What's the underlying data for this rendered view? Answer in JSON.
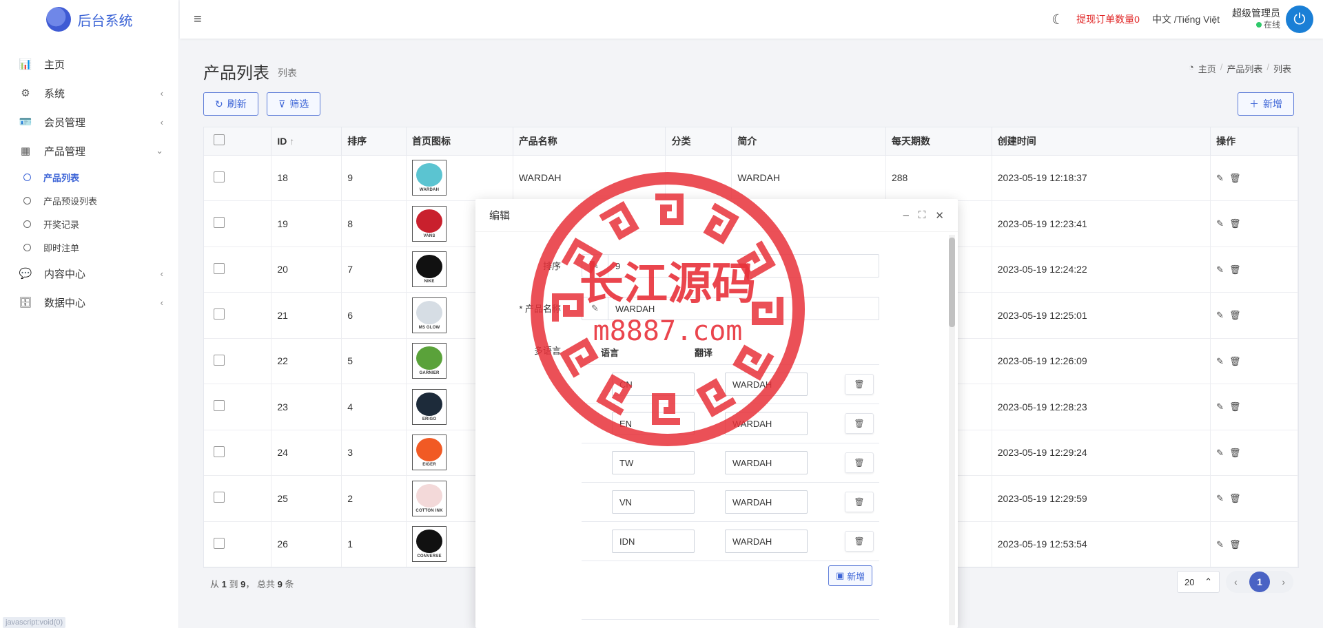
{
  "brand": {
    "name": "后台系统"
  },
  "sidebar": {
    "items": [
      {
        "label": "主页",
        "icon": "bar-chart-icon",
        "glyph": "📊",
        "has_chevron": false
      },
      {
        "label": "系统",
        "icon": "gear-icon",
        "glyph": "⚙",
        "has_chevron": true
      },
      {
        "label": "会员管理",
        "icon": "id-card-icon",
        "glyph": "🪪",
        "has_chevron": true
      },
      {
        "label": "产品管理",
        "icon": "grid-icon",
        "glyph": "▦",
        "has_chevron": true,
        "expanded": true
      }
    ],
    "sub_items": [
      {
        "label": "产品列表",
        "active": true
      },
      {
        "label": "产品预设列表",
        "active": false
      },
      {
        "label": "开奖记录",
        "active": false
      },
      {
        "label": "即时注单",
        "active": false
      }
    ],
    "items_after": [
      {
        "label": "内容中心",
        "icon": "chat-icon",
        "glyph": "💬"
      },
      {
        "label": "数据中心",
        "icon": "database-icon",
        "glyph": "🗄"
      }
    ],
    "status_link": "javascript:void(0)"
  },
  "topbar": {
    "withdraw_label": "提现订单数量",
    "withdraw_count": "0",
    "language": "中文 /Tiếng Việt",
    "user_name": "超级管理员",
    "user_status": "在线"
  },
  "page": {
    "title": "产品列表",
    "subtitle": "列表",
    "breadcrumb": [
      "主页",
      "产品列表",
      "列表"
    ]
  },
  "toolbar": {
    "refresh_label": "刷新",
    "filter_label": "筛选",
    "add_label": "新增"
  },
  "table": {
    "columns": [
      "ID",
      "排序",
      "首页图标",
      "产品名称",
      "分类",
      "简介",
      "每天期数",
      "创建时间",
      "操作"
    ],
    "rows": [
      {
        "id": "18",
        "sort": "9",
        "logo": "WARDAH",
        "logo_color": "#5bc4d1",
        "name": "WARDAH",
        "category": "",
        "intro": "WARDAH",
        "periods": "288",
        "created": "2023-05-19 12:18:37"
      },
      {
        "id": "19",
        "sort": "8",
        "logo": "VANS",
        "logo_color": "#c9202d",
        "name": "",
        "category": "",
        "intro": "",
        "periods": "",
        "created": "2023-05-19 12:23:41"
      },
      {
        "id": "20",
        "sort": "7",
        "logo": "NIKE",
        "logo_color": "#111111",
        "name": "",
        "category": "",
        "intro": "",
        "periods": "",
        "created": "2023-05-19 12:24:22"
      },
      {
        "id": "21",
        "sort": "6",
        "logo": "MS GLOW",
        "logo_color": "#d6dde4",
        "name": "",
        "category": "",
        "intro": "",
        "periods": "",
        "created": "2023-05-19 12:25:01"
      },
      {
        "id": "22",
        "sort": "5",
        "logo": "GARNIER",
        "logo_color": "#5aa23a",
        "name": "",
        "category": "",
        "intro": "",
        "periods": "",
        "created": "2023-05-19 12:26:09"
      },
      {
        "id": "23",
        "sort": "4",
        "logo": "ERIGO",
        "logo_color": "#1d2b3a",
        "name": "",
        "category": "",
        "intro": "",
        "periods": "",
        "created": "2023-05-19 12:28:23"
      },
      {
        "id": "24",
        "sort": "3",
        "logo": "EIGER",
        "logo_color": "#f15a24",
        "name": "",
        "category": "",
        "intro": "",
        "periods": "",
        "created": "2023-05-19 12:29:24"
      },
      {
        "id": "25",
        "sort": "2",
        "logo": "COTTON INK",
        "logo_color": "#f3d9d9",
        "name": "",
        "category": "",
        "intro": "",
        "periods": "",
        "created": "2023-05-19 12:29:59"
      },
      {
        "id": "26",
        "sort": "1",
        "logo": "CONVERSE",
        "logo_color": "#111111",
        "name": "",
        "category": "",
        "intro": "",
        "periods": "",
        "created": "2023-05-19 12:53:54"
      }
    ]
  },
  "pager": {
    "from": "1",
    "to": "9",
    "total": "9",
    "page_size": "20",
    "current": "1"
  },
  "modal": {
    "title": "编辑",
    "sort_label": "排序",
    "sort_value": "9",
    "name_label": "* 产品名称",
    "name_value": "WARDAH",
    "multilang_label": "多语言",
    "lang_col": "语言",
    "trans_col": "翻译",
    "translations": [
      {
        "lang": "CN",
        "text": "WARDAH"
      },
      {
        "lang": "EN",
        "text": "WARDAH"
      },
      {
        "lang": "TW",
        "text": "WARDAH"
      },
      {
        "lang": "VN",
        "text": "WARDAH"
      },
      {
        "lang": "IDN",
        "text": "WARDAH"
      }
    ],
    "add_label": "新增"
  },
  "watermark": {
    "line1": "长江源码",
    "line2": "m8887.com",
    "color": "#e8313a"
  }
}
